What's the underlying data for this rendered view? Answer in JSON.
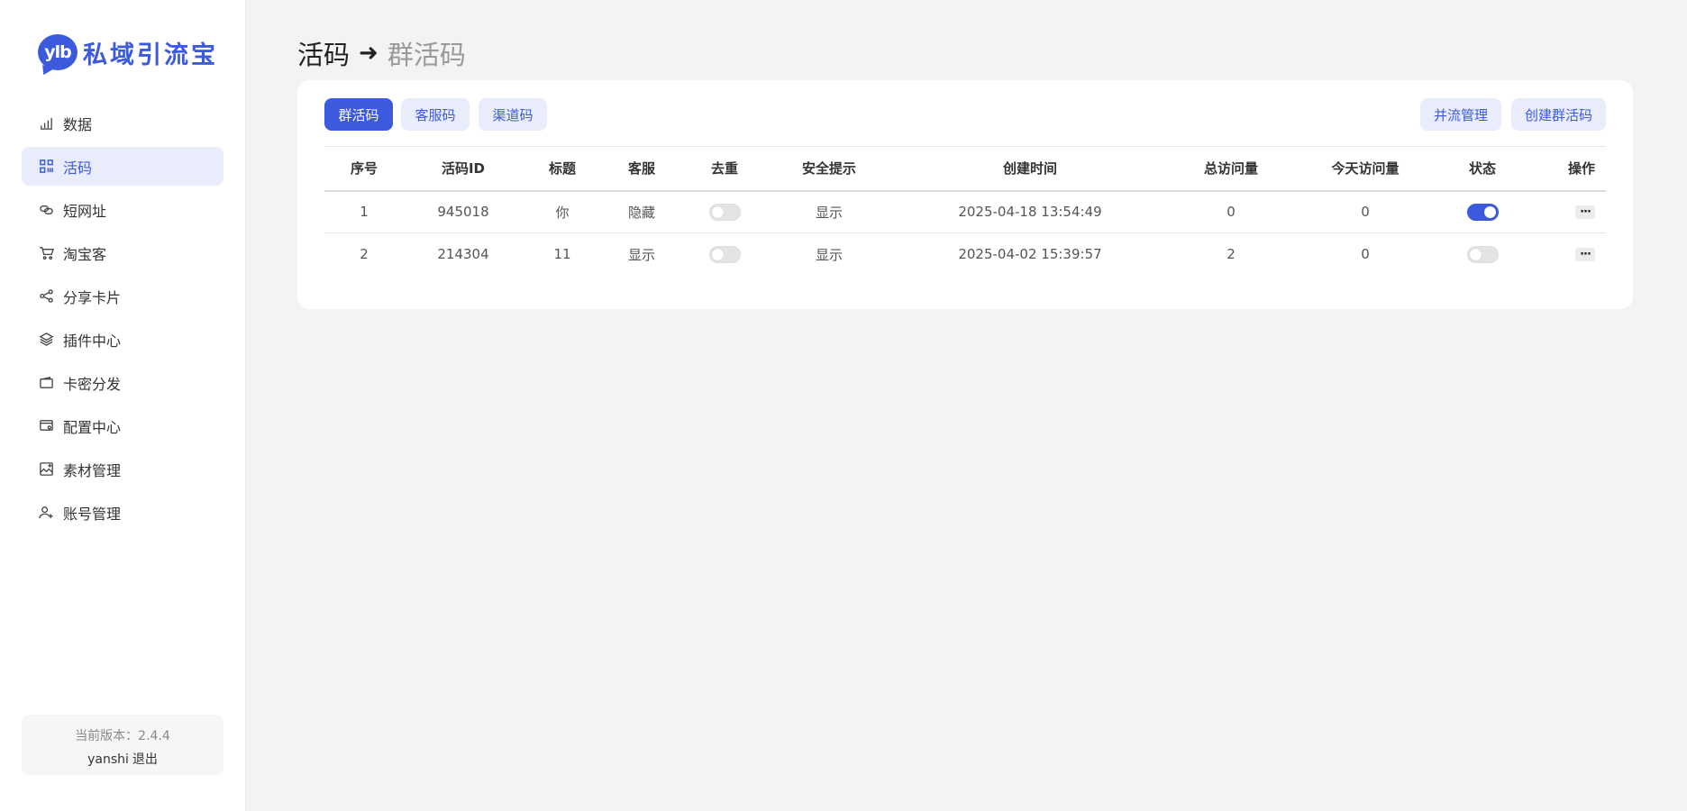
{
  "logo": {
    "badge": "ylb",
    "name": "私域引流宝"
  },
  "nav": {
    "items": [
      {
        "label": "数据",
        "icon": "bar-chart-icon",
        "active": false
      },
      {
        "label": "活码",
        "icon": "grid-icon",
        "active": true
      },
      {
        "label": "短网址",
        "icon": "link-icon",
        "active": false
      },
      {
        "label": "淘宝客",
        "icon": "cart-icon",
        "active": false
      },
      {
        "label": "分享卡片",
        "icon": "share-icon",
        "active": false
      },
      {
        "label": "插件中心",
        "icon": "layers-icon",
        "active": false
      },
      {
        "label": "卡密分发",
        "icon": "wallet-icon",
        "active": false
      },
      {
        "label": "配置中心",
        "icon": "settings-panel-icon",
        "active": false
      },
      {
        "label": "素材管理",
        "icon": "image-icon",
        "active": false
      },
      {
        "label": "账号管理",
        "icon": "user-add-icon",
        "active": false
      }
    ]
  },
  "footer": {
    "version": "当前版本：2.4.4",
    "username": "yanshi",
    "logout": "退出"
  },
  "breadcrumb": {
    "main": "活码",
    "arrow": "➜",
    "sub": "群活码"
  },
  "tabs": {
    "group": "群活码",
    "service": "客服码",
    "channel": "渠道码"
  },
  "actions": {
    "merge": "并流管理",
    "create": "创建群活码"
  },
  "table": {
    "headers": {
      "index": "序号",
      "id": "活码ID",
      "title": "标题",
      "service": "客服",
      "dedupe": "去重",
      "safety": "安全提示",
      "created": "创建时间",
      "total": "总访问量",
      "today": "今天访问量",
      "status": "状态",
      "op": "操作"
    },
    "rows": [
      {
        "index": "1",
        "id": "945018",
        "title": "你",
        "service": "隐藏",
        "dedupe": false,
        "safety": "显示",
        "created": "2025-04-18 13:54:49",
        "total": "0",
        "today": "0",
        "status": true,
        "more": "···"
      },
      {
        "index": "2",
        "id": "214304",
        "title": "11",
        "service": "显示",
        "dedupe": false,
        "safety": "显示",
        "created": "2025-04-02 15:39:57",
        "total": "2",
        "today": "0",
        "status": false,
        "more": "···"
      }
    ]
  },
  "colors": {
    "accent": "#3c5ade",
    "accent_light": "#e8ecfb",
    "background": "#f2f3f3"
  }
}
